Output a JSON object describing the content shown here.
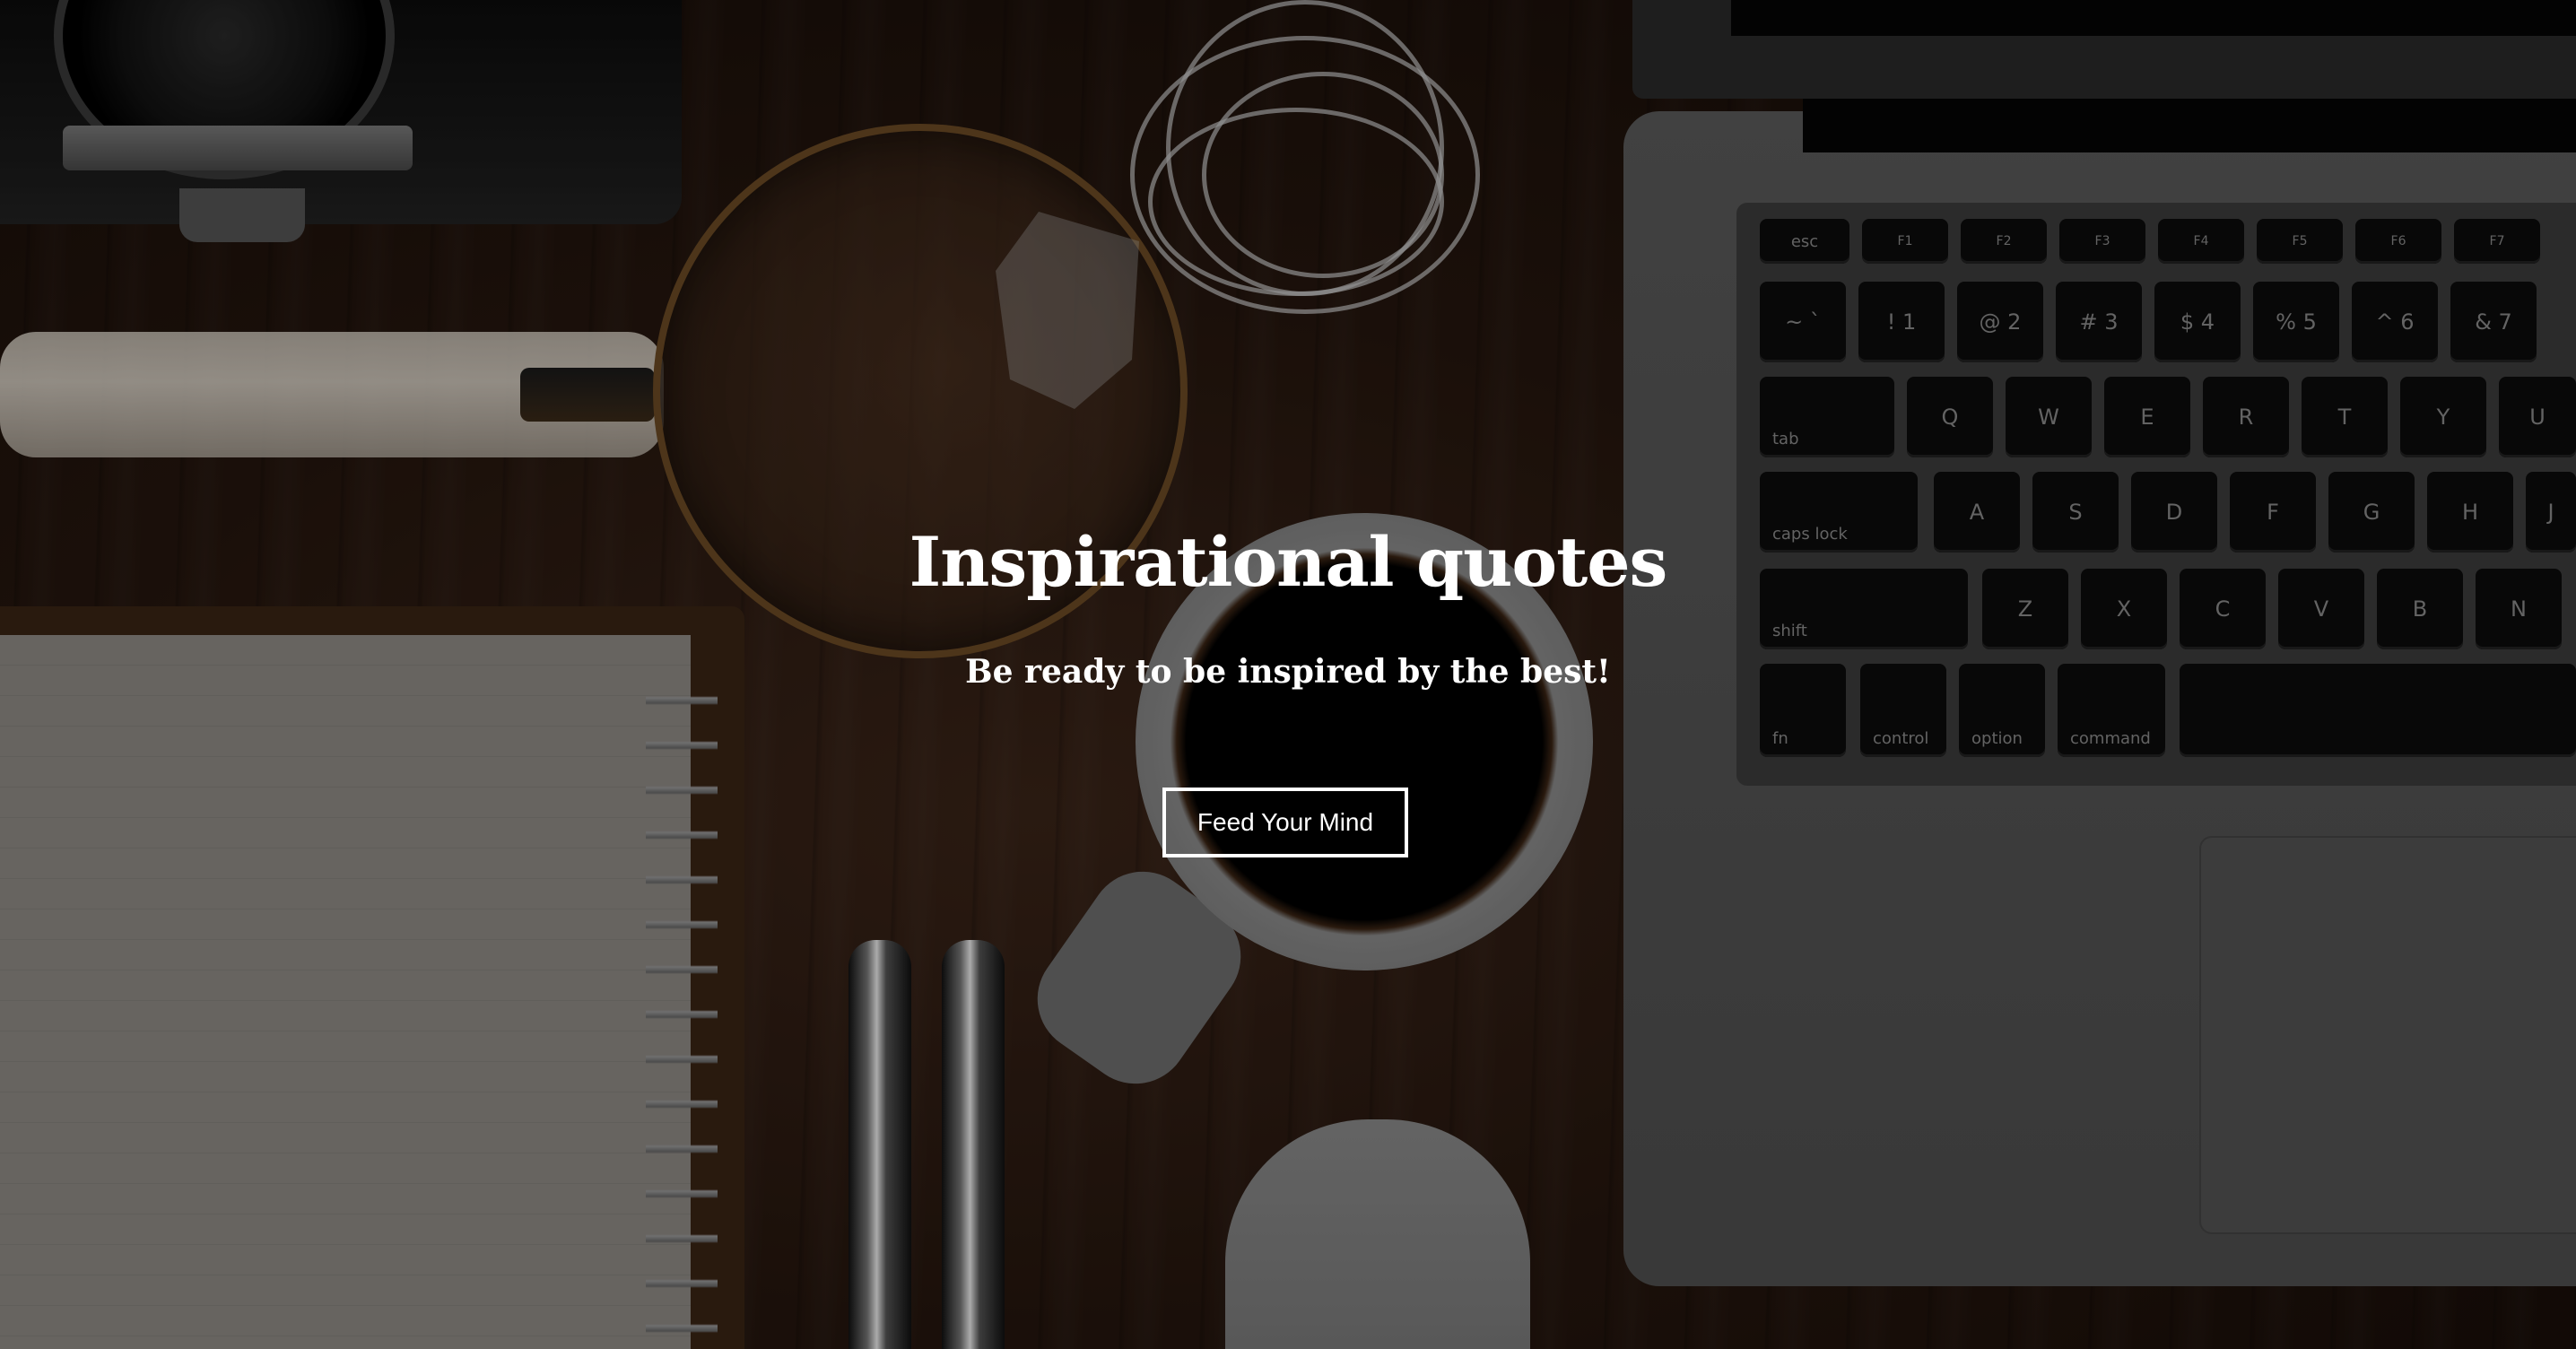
{
  "hero": {
    "title": "Inspirational quotes",
    "subtitle": "Be ready to be inspired by the best!",
    "cta_label": "Feed Your Mind"
  },
  "background": {
    "description_tags": [
      "camera",
      "magnifying-glass",
      "earphones",
      "notebook",
      "pens",
      "coffee-mug",
      "mouse",
      "laptop-keyboard"
    ],
    "keyboard_keys": {
      "row_fn": [
        "esc",
        "F1",
        "F2",
        "F3",
        "F4",
        "F5",
        "F6",
        "F7"
      ],
      "row_num": [
        "~\n`",
        "!\n1",
        "@\n2",
        "#\n3",
        "$\n4",
        "%\n5",
        "^\n6",
        "&\n7"
      ],
      "row_q": [
        "tab",
        "Q",
        "W",
        "E",
        "R",
        "T",
        "Y",
        "U"
      ],
      "row_a": [
        "caps lock",
        "A",
        "S",
        "D",
        "F",
        "G",
        "H",
        "J"
      ],
      "row_z": [
        "shift",
        "Z",
        "X",
        "C",
        "V",
        "B",
        "N"
      ],
      "row_mod": [
        "fn",
        "control",
        "option",
        "command"
      ]
    }
  },
  "colors": {
    "overlay": "#000000",
    "text": "#ffffff",
    "button_border": "#ffffff"
  }
}
